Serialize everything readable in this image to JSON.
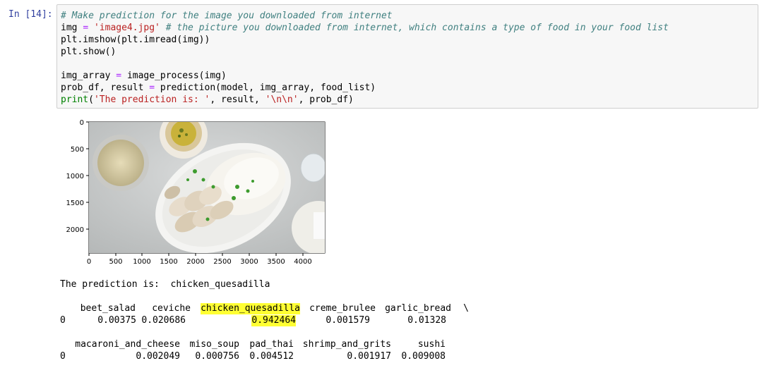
{
  "prompt": "In [14]:",
  "code": {
    "line1_comment": "# Make prediction for the image you downloaded from internet",
    "line2_var": "img",
    "line2_eq": "=",
    "line2_str": "'image4.jpg'",
    "line2_comment": "# the picture you downloaded from internet, which contains a type of food in your food list",
    "line3": "plt.imshow(plt.imread(img))",
    "line4": "plt.show()",
    "line6_var": "img_array",
    "line6_eq": "=",
    "line6_call": "image_process(img)",
    "line7_var": "prob_df, result",
    "line7_eq": "=",
    "line7_call": "prediction(model, img_array, food_list)",
    "line8_fn": "print",
    "line8_open": "(",
    "line8_str1": "'The prediction is: '",
    "line8_mid": ", result, ",
    "line8_str2": "'\\n\\n'",
    "line8_end": ", prob_df)"
  },
  "plot": {
    "y_ticks": [
      "0",
      "500",
      "1000",
      "1500",
      "2000"
    ],
    "x_ticks": [
      "0",
      "500",
      "1000",
      "1500",
      "2000",
      "2500",
      "3000",
      "3500",
      "4000"
    ]
  },
  "output": {
    "prediction_line": "The prediction is:  chicken_quesadilla",
    "table1": {
      "headers": [
        "beet_salad",
        "ceviche",
        "chicken_quesadilla",
        "creme_brulee",
        "garlic_bread",
        "\\"
      ],
      "index": "0",
      "values": [
        "0.00375",
        "0.020686",
        "0.942464",
        "0.001579",
        "0.01328"
      ]
    },
    "table2": {
      "headers": [
        "macaroni_and_cheese",
        "miso_soup",
        "pad_thai",
        "shrimp_and_grits",
        "sushi"
      ],
      "index": "0",
      "values": [
        "0.002049",
        "0.000756",
        "0.004512",
        "0.001917",
        "0.009008"
      ]
    }
  },
  "colors": {
    "highlight": "#ffff33",
    "prompt": "#303f9f"
  }
}
